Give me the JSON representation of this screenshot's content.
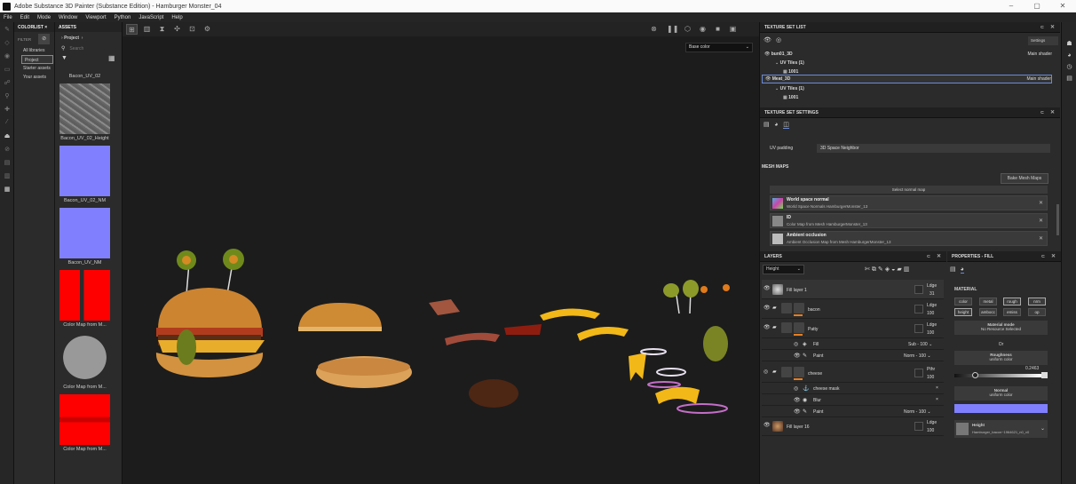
{
  "app": {
    "title": "Adobe Substance 3D Painter (Substance Edition) - Hamburger Monster_04",
    "min": "–",
    "max": "▢",
    "close": "✕"
  },
  "menu": [
    "File",
    "Edit",
    "Mode",
    "Window",
    "Viewport",
    "Python",
    "JavaScript",
    "Help"
  ],
  "colorlist": {
    "tab": "COLORLIST",
    "tab_close": "×",
    "assets_tab": "ASSETS",
    "filter": "FILTER",
    "items": [
      "All libraries",
      "Project",
      "Starter assets",
      "Your assets"
    ]
  },
  "assets": {
    "breadcrumb": "Project",
    "search_placeholder": "Search",
    "partial_top_label": "Bacon_UV_02",
    "thumbs": [
      {
        "label": "Bacon_UV_02_Height",
        "kind": "height"
      },
      {
        "label": "Bacon_UV_02_NM",
        "kind": "normal"
      },
      {
        "label": "Bacon_UV_NM",
        "kind": "normal"
      },
      {
        "label": "Color Map from M...",
        "kind": "red"
      },
      {
        "label": "Color Map from M...",
        "kind": "grey"
      },
      {
        "label": "Color Map from M...",
        "kind": "red2"
      }
    ]
  },
  "viewport": {
    "channel_select": "Base color",
    "channel_arrow": "⌄"
  },
  "texture_set_list": {
    "title": "TEXTURE SET LIST",
    "settings": "Settings",
    "rows": [
      {
        "name": "bun01_3D",
        "shader": "Main shader",
        "selected": false
      },
      {
        "name": "UV Tiles (1)",
        "shader": "",
        "selected": false
      },
      {
        "name": "1001",
        "shader": "",
        "selected": false
      },
      {
        "name": "Meat_3D",
        "shader": "Main shader",
        "selected": true
      },
      {
        "name": "UV Tiles (1)",
        "shader": "",
        "selected": false
      },
      {
        "name": "1001",
        "shader": "",
        "selected": false
      }
    ]
  },
  "texture_set_settings": {
    "title": "TEXTURE SET SETTINGS",
    "uv_padding_label": "UV padding",
    "uv_padding_value": "3D Space Neighbor",
    "mesh_maps": "MESH MAPS",
    "bake_btn": "Bake Mesh Maps",
    "select_normal": "Select normal map",
    "maps": [
      {
        "title": "World space normal",
        "sub": "World Space Normals HamburgerMonster_13"
      },
      {
        "title": "ID",
        "sub": "Color Map from Mesh HamburgerMonster_13"
      },
      {
        "title": "Ambient occlusion",
        "sub": "Ambient Occlusion Map from Mesh HamburgerMonster_13"
      }
    ]
  },
  "layers": {
    "title": "LAYERS",
    "channel": "Height",
    "rows": [
      {
        "name": "Fill layer 1",
        "blend": "Ldge",
        "opacity": "31",
        "kind": "fill",
        "indent": 0
      },
      {
        "name": "bacon",
        "blend": "Ldge",
        "opacity": "100",
        "kind": "folder",
        "indent": 0
      },
      {
        "name": "Patty",
        "blend": "Ldge",
        "opacity": "100",
        "kind": "folder",
        "indent": 0
      },
      {
        "name": "Fill",
        "blend": "Sub",
        "opacity": "100",
        "kind": "sub",
        "indent": 1
      },
      {
        "name": "Paint",
        "blend": "Norm",
        "opacity": "100",
        "kind": "sub",
        "indent": 1
      },
      {
        "name": "cheese",
        "blend": "Pthr",
        "opacity": "100",
        "kind": "folder",
        "indent": 0
      },
      {
        "name": "cheese mask",
        "blend": "",
        "opacity": "",
        "kind": "sub",
        "indent": 1
      },
      {
        "name": "Blur",
        "blend": "",
        "opacity": "",
        "kind": "sub",
        "indent": 1
      },
      {
        "name": "Paint",
        "blend": "Norm",
        "opacity": "100",
        "kind": "sub",
        "indent": 1
      },
      {
        "name": "Fill layer 16",
        "blend": "Ldge",
        "opacity": "100",
        "kind": "fill2",
        "indent": 0
      }
    ]
  },
  "properties": {
    "title": "PROPERTIES - FILL",
    "material": "MATERIAL",
    "chips": [
      "color",
      "metal",
      "rough",
      "nrm",
      "height",
      "ambocc",
      "emiss",
      "op"
    ],
    "material_mode_title": "Material mode",
    "material_mode_value": "No Resource Selected",
    "or": "Or",
    "roughness_title": "Roughness",
    "roughness_sub": "uniform color",
    "roughness_value": "0.2463",
    "normal_title": "Normal",
    "normal_sub": "uniform color",
    "height_title": "Height",
    "height_sub": "Hamburger_bacon~1964621_n0_v0",
    "normal_color": "#8080ff"
  }
}
